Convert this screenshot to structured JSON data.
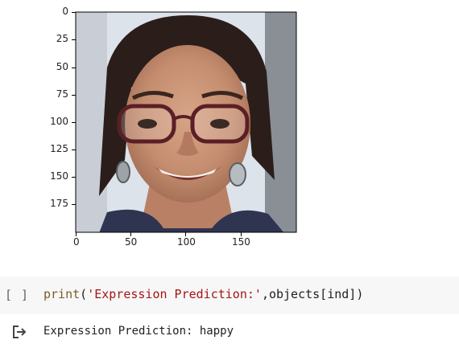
{
  "figure": {
    "image_description_icon": "portrait-photo",
    "y_ticks": [
      "0",
      "25",
      "50",
      "75",
      "100",
      "125",
      "150",
      "175"
    ],
    "x_ticks": [
      "0",
      "50",
      "100",
      "150"
    ]
  },
  "cell": {
    "run_label": "[ ]",
    "code_func": "print",
    "code_open": "(",
    "code_string": "'Expression Prediction:'",
    "code_rest": ",objects[ind])",
    "output_icon": "output-arrow-icon",
    "output_text": "Expression Prediction: happy"
  },
  "colors": {
    "cell_bg": "#f7f7f7",
    "func": "#795e26",
    "string": "#a31515"
  }
}
